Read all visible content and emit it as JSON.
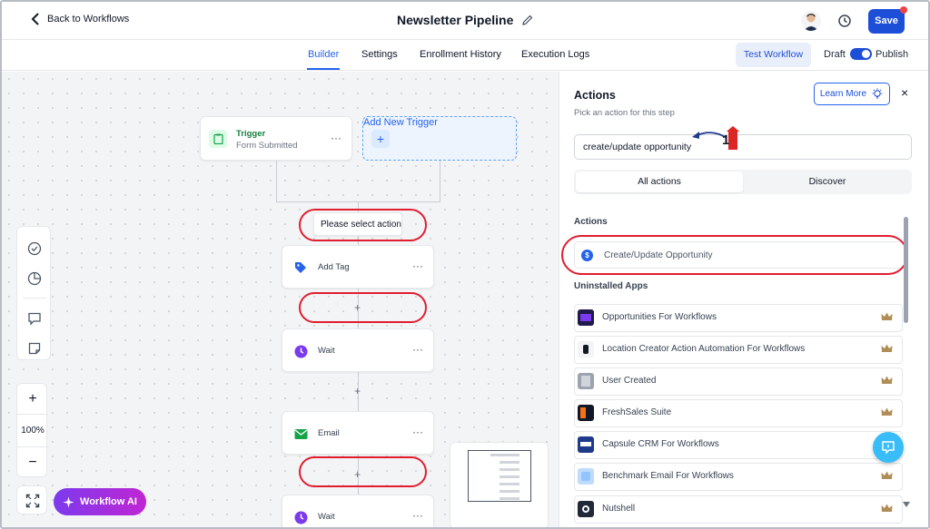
{
  "header": {
    "back_label": "Back to Workflows",
    "title": "Newsletter Pipeline",
    "save_label": "Save"
  },
  "tabs": [
    "Builder",
    "Settings",
    "Enrollment History",
    "Execution Logs"
  ],
  "active_tab": "Builder",
  "toolbar": {
    "test_label": "Test Workflow",
    "draft_label": "Draft",
    "publish_label": "Publish",
    "publish_on": true
  },
  "canvas": {
    "trigger_title": "Trigger",
    "trigger_sub": "Form Submitted",
    "add_trigger": "Add New Trigger",
    "select_action": "Please select action",
    "steps": [
      "Add Tag",
      "Wait",
      "Email",
      "Wait"
    ],
    "plus": "+",
    "zoom_in": "+",
    "zoom_level": "100%",
    "zoom_out": "−",
    "ai_label": "Workflow AI"
  },
  "panel": {
    "title": "Actions",
    "subtitle": "Pick an action for this step",
    "learn_more": "Learn More",
    "close": "×",
    "search_value": "create/update opportunity",
    "segments": [
      "All actions",
      "Discover"
    ],
    "actions_header": "Actions",
    "action_item": "Create/Update Opportunity",
    "uninstalled_header": "Uninstalled Apps",
    "apps": [
      "Opportunities For Workflows",
      "Location Creator Action Automation For Workflows",
      "User Created",
      "FreshSales Suite",
      "Capsule CRM For Workflows",
      "Benchmark Email For Workflows",
      "Nutshell"
    ]
  },
  "annotation": {
    "marker": "1"
  },
  "colors": {
    "accent": "#2563eb",
    "highlight": "#e11d2f",
    "save": "#1d4ed8",
    "ai_gradient_start": "#7c3aed",
    "ai_gradient_end": "#c026d3"
  }
}
